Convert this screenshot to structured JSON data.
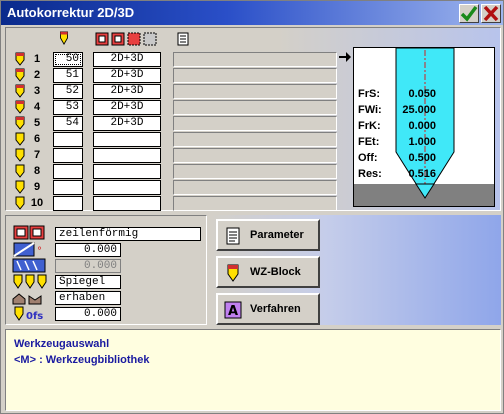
{
  "window": {
    "title": "Autokorrektur 2D/3D"
  },
  "tools": [
    {
      "num": "1",
      "tool": "50",
      "mode": "2D+3D"
    },
    {
      "num": "2",
      "tool": "51",
      "mode": "2D+3D"
    },
    {
      "num": "3",
      "tool": "52",
      "mode": "2D+3D"
    },
    {
      "num": "4",
      "tool": "53",
      "mode": "2D+3D"
    },
    {
      "num": "5",
      "tool": "54",
      "mode": "2D+3D"
    },
    {
      "num": "6",
      "tool": "",
      "mode": ""
    },
    {
      "num": "7",
      "tool": "",
      "mode": ""
    },
    {
      "num": "8",
      "tool": "",
      "mode": ""
    },
    {
      "num": "9",
      "tool": "",
      "mode": ""
    },
    {
      "num": "10",
      "tool": "",
      "mode": ""
    }
  ],
  "preview": {
    "labels": [
      "FrS:",
      "FWi:",
      "FrK:",
      "FEt:",
      "Off:",
      "Res:"
    ],
    "values": [
      "0.050",
      "25.000",
      "0.000",
      "1.000",
      "0.500",
      "0.516"
    ]
  },
  "settings": {
    "pattern": "zeilenförmig",
    "value1": "0.000",
    "value2": "0.000",
    "mirror": "Spiegel",
    "relief": "erhaben",
    "offset": "0.000"
  },
  "buttons": {
    "parameter": "Parameter",
    "wz_block": "WZ-Block",
    "verfahren": "Verfahren"
  },
  "status": {
    "line1": "Werkzeugauswahl",
    "line2": "<M> : Werkzeugbibliothek"
  }
}
